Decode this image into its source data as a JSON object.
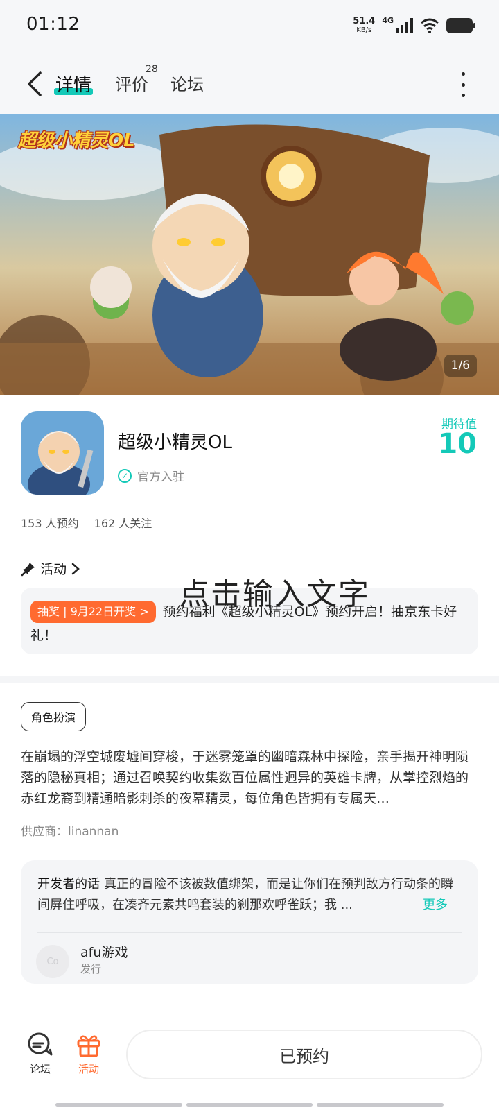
{
  "status_bar": {
    "time": "01:12",
    "net_speed_value": "51.4",
    "net_speed_unit": "KB/s",
    "network_type": "4G"
  },
  "nav": {
    "tabs": [
      {
        "label": "详情"
      },
      {
        "label": "评价",
        "count": "28"
      },
      {
        "label": "论坛"
      }
    ]
  },
  "banner": {
    "logo_text": "超级小精灵OL",
    "counter": "1/6"
  },
  "app": {
    "name": "超级小精灵OL",
    "official_label": "官方入驻",
    "expect_label": "期待值",
    "expect_value": "10",
    "reservations": "153 人预约",
    "followers": "162 人关注"
  },
  "activity": {
    "header": "活动",
    "tag": "抽奖 | 9月22日开奖 >",
    "text": "预约福利《超级小精灵OL》预约开启！抽京东卡好礼！"
  },
  "overlay_text": "点击输入文字",
  "description": {
    "genre": "角色扮演",
    "text": "在崩塌的浮空城废墟间穿梭，于迷雾笼罩的幽暗森林中探险，亲手揭开神明陨落的隐秘真相；通过召唤契约收集数百位属性迥异的英雄卡牌，从掌控烈焰的赤红龙裔到精通暗影刺杀的夜幕精灵，每位角色皆拥有专属天…",
    "supplier": "供应商：linannan"
  },
  "developer": {
    "title": "开发者的话",
    "text": "真正的冒险不该被数值绑架，而是让你们在预判敌方行动条的瞬间屏住呼吸，在凑齐元素共鸣套装的刹那欢呼雀跃；我 ...",
    "more": "更多",
    "avatar_text": "Co",
    "name": "afu游戏",
    "role": "发行"
  },
  "bottom_bar": {
    "forum_label": "论坛",
    "activity_label": "活动",
    "reserve_label": "已预约"
  },
  "colors": {
    "accent": "#14c9b8",
    "orange": "#ff6a30"
  }
}
